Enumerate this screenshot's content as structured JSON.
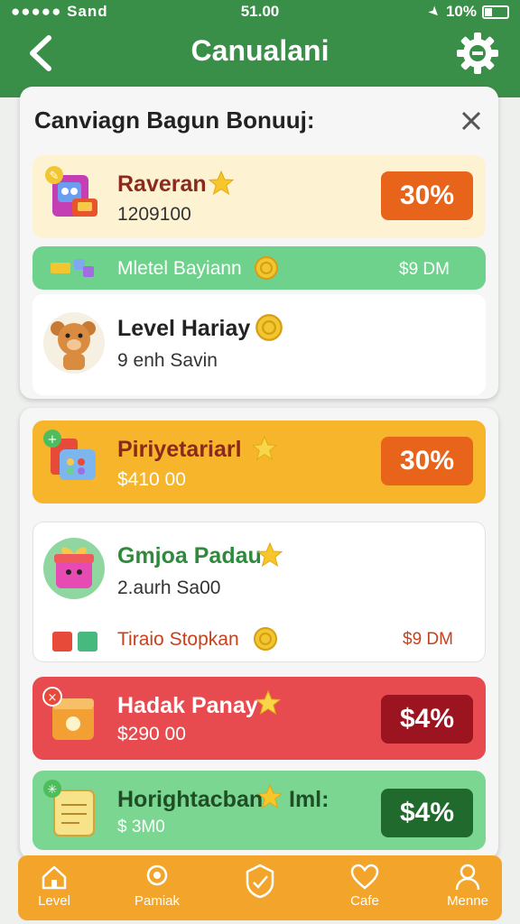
{
  "status_bar": {
    "carrier": "●●●●● Sand",
    "time": "51.00",
    "battery": "10%"
  },
  "header": {
    "title": "Canualani"
  },
  "modal": {
    "title": "Canviagn Bagun Bonuuj:"
  },
  "rows": {
    "raveran": {
      "title": "Raveran",
      "sub": "1209100",
      "pct": "30%"
    },
    "strip": {
      "title": "Mletel Bayiann",
      "price": "$9 DM"
    },
    "level": {
      "title": "Level Hariay",
      "sub": "9 enh Savin"
    },
    "piriy": {
      "title": "Piriyetariarl",
      "sub": "$410 00",
      "pct": "30%"
    },
    "gmjoa": {
      "title": "Gmjoa Padau",
      "sub": "2.aurh Sa00",
      "sub2_title": "Tiraio Stopkan",
      "sub2_price": "$9 DM"
    },
    "hadak": {
      "title": "Hadak Panay",
      "sub": "$290 00",
      "pct": "$4%"
    },
    "horig": {
      "title": "Horightacban",
      "extra": "Iml:",
      "sub": "$ 3M0",
      "pct": "$4%"
    }
  },
  "nav": {
    "items": [
      "Level",
      "Pamiak",
      "",
      "Cafe",
      "Menne"
    ]
  },
  "colors": {
    "brand_green": "#3a8f48",
    "orange": "#f2a52a",
    "red": "#e74b4f"
  }
}
